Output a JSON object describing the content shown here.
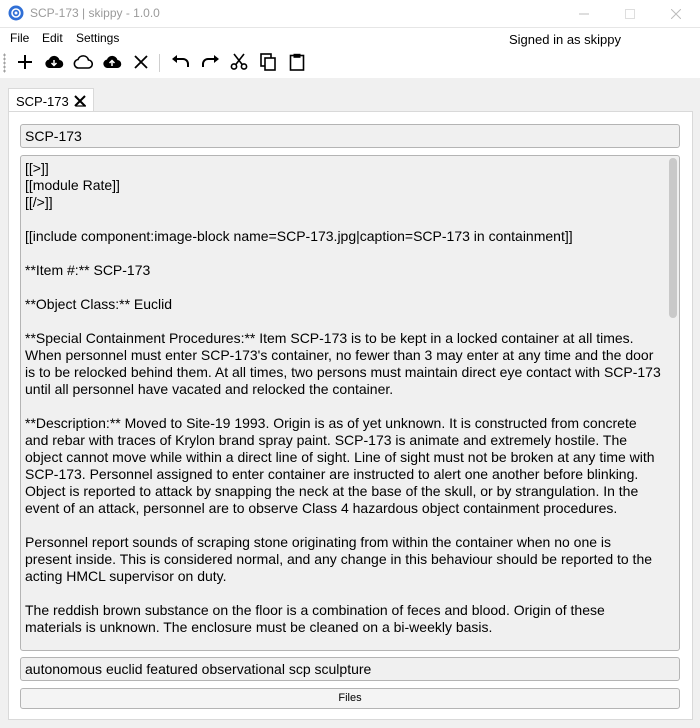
{
  "window": {
    "title": "SCP-173 | skippy - 1.0.0",
    "app_icon": "app-logo-icon",
    "controls": [
      "minimize-icon",
      "maximize-icon",
      "close-icon"
    ]
  },
  "menu": {
    "file": "File",
    "edit": "Edit",
    "settings": "Settings"
  },
  "status": {
    "signed_in": "Signed in as skippy"
  },
  "toolbar": {
    "icons": [
      "add-icon",
      "cloud-download-icon",
      "cloud-icon",
      "cloud-upload-icon",
      "close-icon",
      "undo-icon",
      "redo-icon",
      "cut-icon",
      "copy-icon",
      "paste-icon"
    ]
  },
  "tab": {
    "label": "SCP-173",
    "close_icon": "tab-close-icon"
  },
  "page": {
    "title": "SCP-173",
    "body": "[[>]]\n[[module Rate]]\n[[/>]]\n\n[[include component:image-block name=SCP-173.jpg|caption=SCP-173 in containment]]\n\n**Item #:** SCP-173\n\n**Object Class:** Euclid\n\n**Special Containment Procedures:** Item SCP-173 is to be kept in a locked container at all times. When personnel must enter SCP-173's container, no fewer than 3 may enter at any time and the door is to be relocked behind them. At all times, two persons must maintain direct eye contact with SCP-173 until all personnel have vacated and relocked the container.\n\n**Description:** Moved to Site-19 1993. Origin is as of yet unknown. It is constructed from concrete and rebar with traces of Krylon brand spray paint. SCP-173 is animate and extremely hostile. The object cannot move while within a direct line of sight. Line of sight must not be broken at any time with SCP-173. Personnel assigned to enter container are instructed to alert one another before blinking. Object is reported to attack by snapping the neck at the base of the skull, or by strangulation. In the event of an attack, personnel are to observe Class 4 hazardous object containment procedures.\n\nPersonnel report sounds of scraping stone originating from within the container when no one is present inside. This is considered normal, and any change in this behaviour should be reported to the acting HMCL supervisor on duty.\n\nThe reddish brown substance on the floor is a combination of feces and blood. Origin of these materials is unknown. The enclosure must be cleaned on a bi-weekly basis.",
    "tags": "autonomous euclid featured observational scp sculpture",
    "files_button": "Files"
  }
}
